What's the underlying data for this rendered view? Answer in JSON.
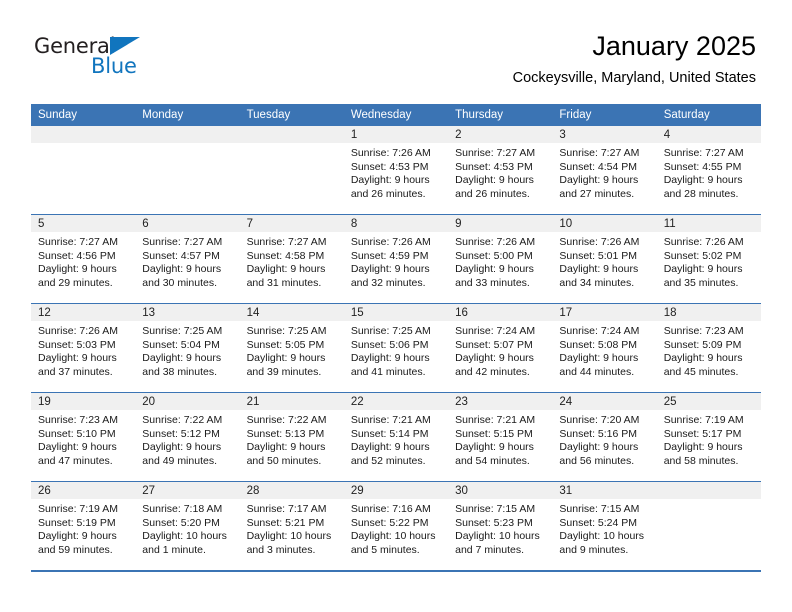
{
  "brand": {
    "name_part1": "General",
    "name_part2": "Blue",
    "triangle_color": "#1175be"
  },
  "header": {
    "title": "January 2025",
    "subtitle": "Cockeysville, Maryland, United States"
  },
  "theme": {
    "header_blue": "#3b74b4",
    "daynum_band": "#f0f0f0",
    "text": "#000000"
  },
  "calendar": {
    "weekday_headers": [
      "Sunday",
      "Monday",
      "Tuesday",
      "Wednesday",
      "Thursday",
      "Friday",
      "Saturday"
    ],
    "weeks": [
      [
        {
          "day": "",
          "empty": true
        },
        {
          "day": "",
          "empty": true
        },
        {
          "day": "",
          "empty": true
        },
        {
          "day": "1",
          "sunrise": "Sunrise: 7:26 AM",
          "sunset": "Sunset: 4:53 PM",
          "daylight1": "Daylight: 9 hours",
          "daylight2": "and 26 minutes."
        },
        {
          "day": "2",
          "sunrise": "Sunrise: 7:27 AM",
          "sunset": "Sunset: 4:53 PM",
          "daylight1": "Daylight: 9 hours",
          "daylight2": "and 26 minutes."
        },
        {
          "day": "3",
          "sunrise": "Sunrise: 7:27 AM",
          "sunset": "Sunset: 4:54 PM",
          "daylight1": "Daylight: 9 hours",
          "daylight2": "and 27 minutes."
        },
        {
          "day": "4",
          "sunrise": "Sunrise: 7:27 AM",
          "sunset": "Sunset: 4:55 PM",
          "daylight1": "Daylight: 9 hours",
          "daylight2": "and 28 minutes."
        }
      ],
      [
        {
          "day": "5",
          "sunrise": "Sunrise: 7:27 AM",
          "sunset": "Sunset: 4:56 PM",
          "daylight1": "Daylight: 9 hours",
          "daylight2": "and 29 minutes."
        },
        {
          "day": "6",
          "sunrise": "Sunrise: 7:27 AM",
          "sunset": "Sunset: 4:57 PM",
          "daylight1": "Daylight: 9 hours",
          "daylight2": "and 30 minutes."
        },
        {
          "day": "7",
          "sunrise": "Sunrise: 7:27 AM",
          "sunset": "Sunset: 4:58 PM",
          "daylight1": "Daylight: 9 hours",
          "daylight2": "and 31 minutes."
        },
        {
          "day": "8",
          "sunrise": "Sunrise: 7:26 AM",
          "sunset": "Sunset: 4:59 PM",
          "daylight1": "Daylight: 9 hours",
          "daylight2": "and 32 minutes."
        },
        {
          "day": "9",
          "sunrise": "Sunrise: 7:26 AM",
          "sunset": "Sunset: 5:00 PM",
          "daylight1": "Daylight: 9 hours",
          "daylight2": "and 33 minutes."
        },
        {
          "day": "10",
          "sunrise": "Sunrise: 7:26 AM",
          "sunset": "Sunset: 5:01 PM",
          "daylight1": "Daylight: 9 hours",
          "daylight2": "and 34 minutes."
        },
        {
          "day": "11",
          "sunrise": "Sunrise: 7:26 AM",
          "sunset": "Sunset: 5:02 PM",
          "daylight1": "Daylight: 9 hours",
          "daylight2": "and 35 minutes."
        }
      ],
      [
        {
          "day": "12",
          "sunrise": "Sunrise: 7:26 AM",
          "sunset": "Sunset: 5:03 PM",
          "daylight1": "Daylight: 9 hours",
          "daylight2": "and 37 minutes."
        },
        {
          "day": "13",
          "sunrise": "Sunrise: 7:25 AM",
          "sunset": "Sunset: 5:04 PM",
          "daylight1": "Daylight: 9 hours",
          "daylight2": "and 38 minutes."
        },
        {
          "day": "14",
          "sunrise": "Sunrise: 7:25 AM",
          "sunset": "Sunset: 5:05 PM",
          "daylight1": "Daylight: 9 hours",
          "daylight2": "and 39 minutes."
        },
        {
          "day": "15",
          "sunrise": "Sunrise: 7:25 AM",
          "sunset": "Sunset: 5:06 PM",
          "daylight1": "Daylight: 9 hours",
          "daylight2": "and 41 minutes."
        },
        {
          "day": "16",
          "sunrise": "Sunrise: 7:24 AM",
          "sunset": "Sunset: 5:07 PM",
          "daylight1": "Daylight: 9 hours",
          "daylight2": "and 42 minutes."
        },
        {
          "day": "17",
          "sunrise": "Sunrise: 7:24 AM",
          "sunset": "Sunset: 5:08 PM",
          "daylight1": "Daylight: 9 hours",
          "daylight2": "and 44 minutes."
        },
        {
          "day": "18",
          "sunrise": "Sunrise: 7:23 AM",
          "sunset": "Sunset: 5:09 PM",
          "daylight1": "Daylight: 9 hours",
          "daylight2": "and 45 minutes."
        }
      ],
      [
        {
          "day": "19",
          "sunrise": "Sunrise: 7:23 AM",
          "sunset": "Sunset: 5:10 PM",
          "daylight1": "Daylight: 9 hours",
          "daylight2": "and 47 minutes."
        },
        {
          "day": "20",
          "sunrise": "Sunrise: 7:22 AM",
          "sunset": "Sunset: 5:12 PM",
          "daylight1": "Daylight: 9 hours",
          "daylight2": "and 49 minutes."
        },
        {
          "day": "21",
          "sunrise": "Sunrise: 7:22 AM",
          "sunset": "Sunset: 5:13 PM",
          "daylight1": "Daylight: 9 hours",
          "daylight2": "and 50 minutes."
        },
        {
          "day": "22",
          "sunrise": "Sunrise: 7:21 AM",
          "sunset": "Sunset: 5:14 PM",
          "daylight1": "Daylight: 9 hours",
          "daylight2": "and 52 minutes."
        },
        {
          "day": "23",
          "sunrise": "Sunrise: 7:21 AM",
          "sunset": "Sunset: 5:15 PM",
          "daylight1": "Daylight: 9 hours",
          "daylight2": "and 54 minutes."
        },
        {
          "day": "24",
          "sunrise": "Sunrise: 7:20 AM",
          "sunset": "Sunset: 5:16 PM",
          "daylight1": "Daylight: 9 hours",
          "daylight2": "and 56 minutes."
        },
        {
          "day": "25",
          "sunrise": "Sunrise: 7:19 AM",
          "sunset": "Sunset: 5:17 PM",
          "daylight1": "Daylight: 9 hours",
          "daylight2": "and 58 minutes."
        }
      ],
      [
        {
          "day": "26",
          "sunrise": "Sunrise: 7:19 AM",
          "sunset": "Sunset: 5:19 PM",
          "daylight1": "Daylight: 9 hours",
          "daylight2": "and 59 minutes."
        },
        {
          "day": "27",
          "sunrise": "Sunrise: 7:18 AM",
          "sunset": "Sunset: 5:20 PM",
          "daylight1": "Daylight: 10 hours",
          "daylight2": "and 1 minute."
        },
        {
          "day": "28",
          "sunrise": "Sunrise: 7:17 AM",
          "sunset": "Sunset: 5:21 PM",
          "daylight1": "Daylight: 10 hours",
          "daylight2": "and 3 minutes."
        },
        {
          "day": "29",
          "sunrise": "Sunrise: 7:16 AM",
          "sunset": "Sunset: 5:22 PM",
          "daylight1": "Daylight: 10 hours",
          "daylight2": "and 5 minutes."
        },
        {
          "day": "30",
          "sunrise": "Sunrise: 7:15 AM",
          "sunset": "Sunset: 5:23 PM",
          "daylight1": "Daylight: 10 hours",
          "daylight2": "and 7 minutes."
        },
        {
          "day": "31",
          "sunrise": "Sunrise: 7:15 AM",
          "sunset": "Sunset: 5:24 PM",
          "daylight1": "Daylight: 10 hours",
          "daylight2": "and 9 minutes."
        },
        {
          "day": "",
          "empty": true
        }
      ]
    ]
  }
}
